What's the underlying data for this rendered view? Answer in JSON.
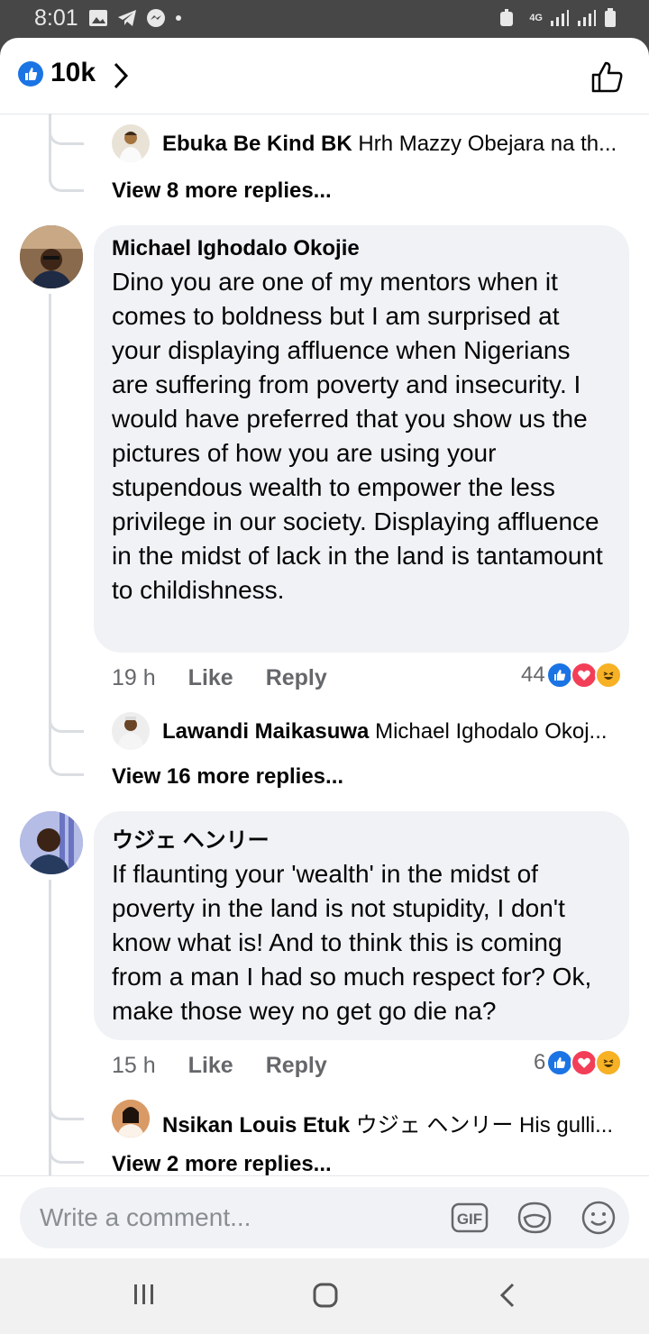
{
  "status_bar": {
    "time": "8:01",
    "network": "4G"
  },
  "header": {
    "like_count": "10k"
  },
  "thread_top": {
    "reply_preview": {
      "name": "Ebuka Be Kind BK",
      "text": "Hrh Mazzy Obejara na th..."
    },
    "view_more": "View 8 more replies..."
  },
  "comments": [
    {
      "author": "Michael Ighodalo Okojie",
      "text": "Dino you are one of  my mentors when it comes to boldness but I am surprised at your displaying affluence when Nigerians are suffering from poverty and insecurity. I would have preferred that you show us the pictures of how you are using your stupendous wealth to empower the less privilege in our society. Displaying affluence in the midst of lack in the land is tantamount to childishness.",
      "time": "19 h",
      "like_label": "Like",
      "reply_label": "Reply",
      "reaction_count": "44",
      "reply_preview": {
        "name": "Lawandi Maikasuwa",
        "text": "Michael Ighodalo Okoj..."
      },
      "view_more": "View 16 more replies..."
    },
    {
      "author": "ウジェ ヘンリー",
      "text": "If flaunting your 'wealth' in the midst of poverty in the land is not stupidity, I don't know what is! And to think this is coming from a man I had so much respect for? Ok, make those wey no get go die na?",
      "time": "15 h",
      "like_label": "Like",
      "reply_label": "Reply",
      "reaction_count": "6",
      "reply_preview": {
        "name": "Nsikan Louis Etuk",
        "text": "ウジェ ヘンリー His gulli..."
      },
      "view_more": "View 2 more replies..."
    }
  ],
  "composer": {
    "placeholder": "Write a comment...",
    "gif_label": "GIF"
  },
  "colors": {
    "facebook_blue": "#1b74e4",
    "love_red": "#f33e58",
    "haha_yellow": "#f7b125",
    "bubble_grey": "#f0f2f5"
  }
}
